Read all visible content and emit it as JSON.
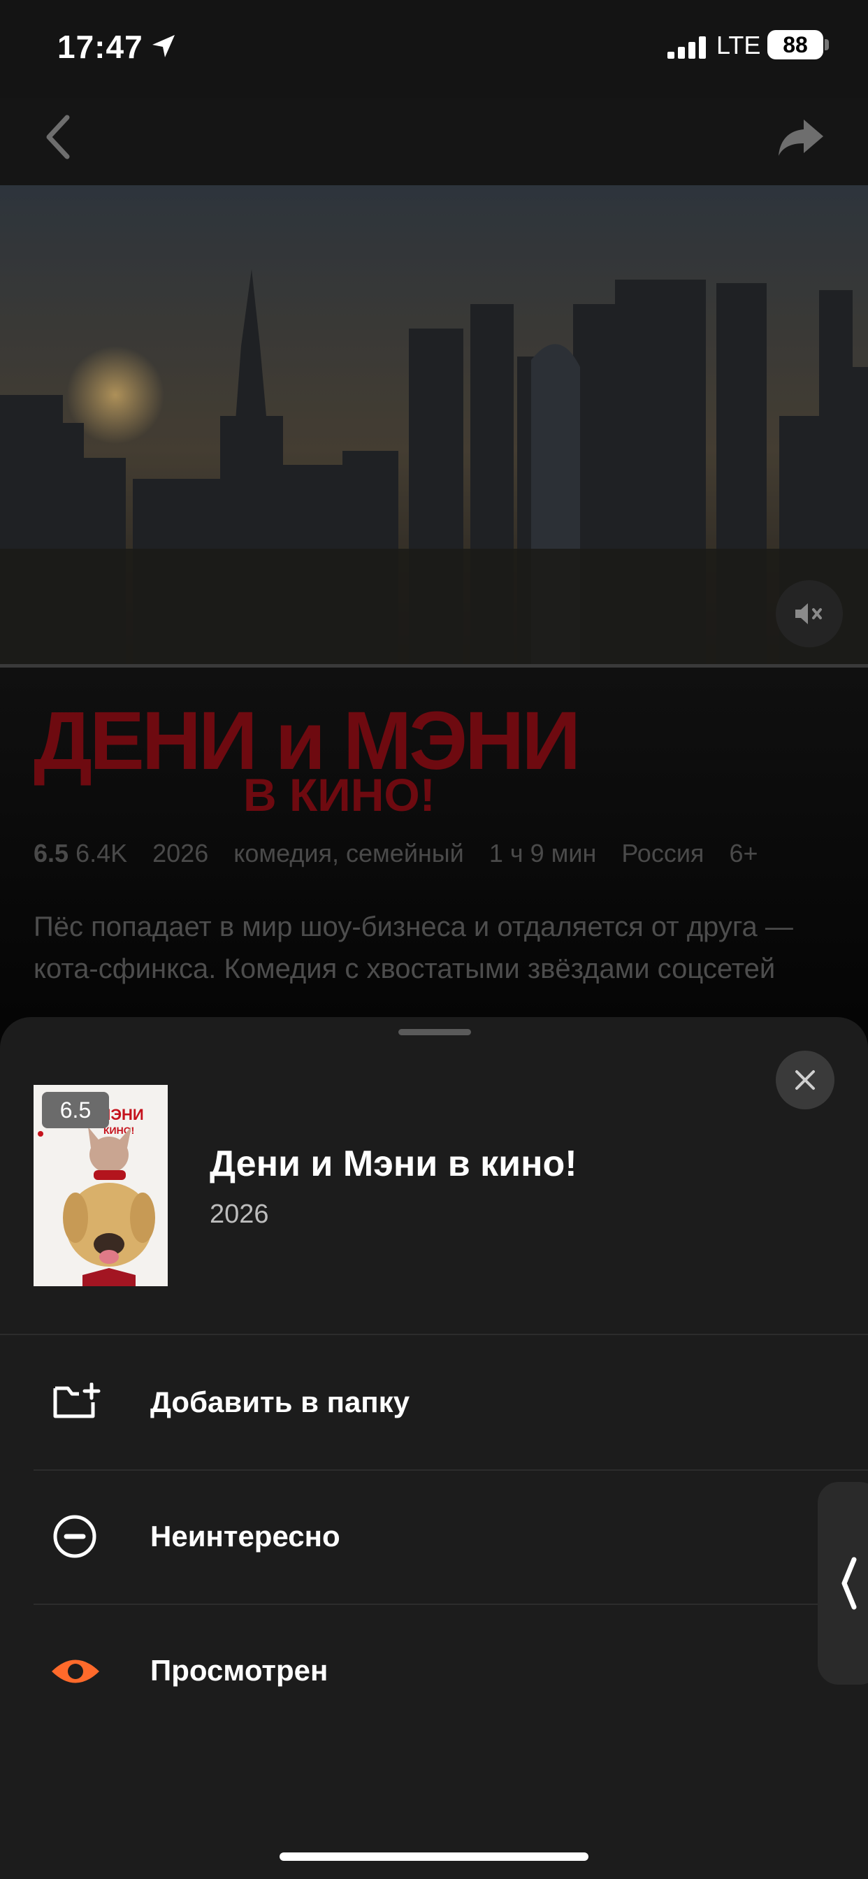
{
  "status_bar": {
    "time": "17:47",
    "network": "LTE",
    "battery": "88"
  },
  "movie": {
    "logo_line1": "ДЕНИ и МЭНИ",
    "logo_line2": "В КИНО!",
    "rating": "6.5",
    "votes": "6.4K",
    "year": "2026",
    "genres": "комедия, семейный",
    "duration": "1 ч 9 мин",
    "country": "Россия",
    "age": "6+",
    "description": "Пёс попадает в мир шоу-бизнеса и отдаляется от друга — кота-сфинкса. Комедия с хвостатыми звёздами соцсетей"
  },
  "sheet": {
    "rating_badge": "6.5",
    "title": "Дени и Мэни в кино!",
    "year": "2026",
    "poster_text": "МЭНИ\nКИНО!",
    "actions": [
      {
        "label": "Добавить в папку",
        "icon": "folder-add-icon"
      },
      {
        "label": "Неинтересно",
        "icon": "minus-circle-icon"
      },
      {
        "label": "Просмотрен",
        "icon": "eye-icon",
        "color": "#ff6a2b"
      }
    ]
  },
  "colors": {
    "accent": "#ff6a2b",
    "logo_red": "#6e0a10",
    "sheet_bg": "#1c1c1c"
  }
}
